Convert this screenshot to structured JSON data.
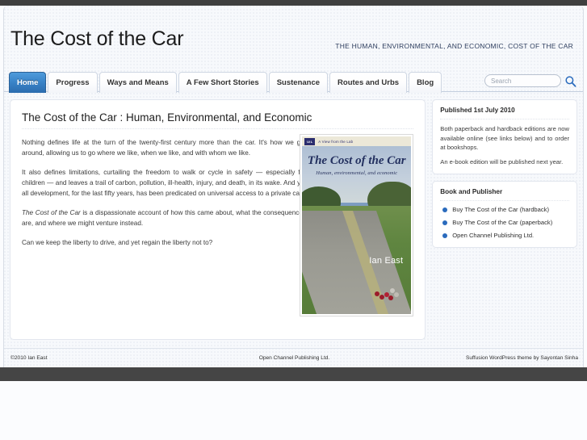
{
  "site": {
    "title": "The Cost of the Car",
    "tagline": "THE HUMAN, ENVIRONMENTAL, AND ECONOMIC, COST OF THE CAR"
  },
  "nav": {
    "items": [
      {
        "label": "Home",
        "active": true
      },
      {
        "label": "Progress",
        "active": false
      },
      {
        "label": "Ways and Means",
        "active": false
      },
      {
        "label": "A Few Short Stories",
        "active": false
      },
      {
        "label": "Sustenance",
        "active": false
      },
      {
        "label": "Routes and Urbs",
        "active": false
      },
      {
        "label": "Blog",
        "active": false
      }
    ]
  },
  "search": {
    "placeholder": "Search",
    "value": "",
    "icon": "search-icon"
  },
  "post": {
    "title": "The Cost of the Car : Human, Environmental, and Economic",
    "paragraphs": [
      "Nothing defines life at the turn of the twenty-first century more than the car.  It's how we get around, allowing us to go where we like, when we like, and with whom we like.",
      "It also defines limitations, curtailing the freedom to walk or cycle in safety — especially for children — and leaves a trail of carbon, pollution, ill-health, injury, and death, in its wake.  And yet all development, for the last fifty years, has been predicated on universal access to a private car.",
      "Can we keep the liberty to drive, and yet regain the liberty not to?"
    ],
    "italic_paragraph": {
      "emphasis": "The Cost of the Car",
      "rest": " is a dispassionate account of how this came about, what the consequences are, and where we might venture instead."
    }
  },
  "cover": {
    "logo": "UiL",
    "series": "A View from the Lab",
    "title": "The Cost of the Car",
    "subtitle": "Human, environmental, and economic",
    "author": "Ian East"
  },
  "sidebar": {
    "widgets": [
      {
        "title": "Published 1st July 2010",
        "paragraphs": [
          "Both paperback and hardback editions are now available online (see links below) and to order at bookshops.",
          "An e-book edition will be published next year."
        ]
      },
      {
        "title": "Book and Publisher",
        "links": [
          "Buy The Cost of the Car (hardback)",
          "Buy The Cost of the Car (paperback)",
          "Open Channel Publishing Ltd."
        ]
      }
    ]
  },
  "footer": {
    "left": "©2010 Ian East",
    "center": "Open Channel Publishing Ltd.",
    "right": "Suffusion WordPress theme by Sayontan Sinha"
  },
  "colors": {
    "accent": "#2a6bbd",
    "nav_active_top": "#4f9bdb",
    "nav_active_bottom": "#2b6cae",
    "page_bg": "#f7f9fc",
    "chrome": "#3f3f3f"
  }
}
